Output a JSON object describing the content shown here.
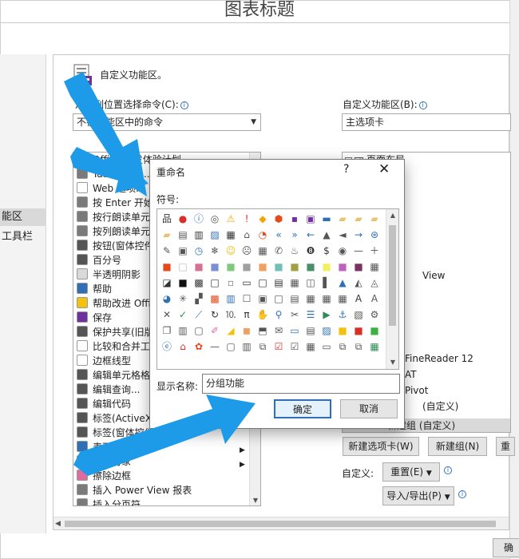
{
  "window": {
    "title": "图表标题",
    "partial_button": "确"
  },
  "nav": {
    "items": [
      {
        "label": "能区",
        "selected": true
      },
      {
        "label": "工具栏",
        "selected": false
      }
    ]
  },
  "panel": {
    "header": "自定义功能区。",
    "left_label": "从下列位置选择命令(C):",
    "left_combo": "不在功能区中的命令",
    "right_label": "自定义功能区(B):",
    "right_combo": "主选项卡"
  },
  "commands": [
    {
      "label": "Office 开发体验计划",
      "icon_color": "#e64a19"
    },
    {
      "label": "Tab 键次序...",
      "icon_color": "#7a7a7a"
    },
    {
      "label": "Web 选项...",
      "icon_color": "#ffffff"
    },
    {
      "label": "按 Enter 开始",
      "icon_color": "#7a7a7a"
    },
    {
      "label": "按行朗读单元格",
      "icon_color": "#7a7a7a"
    },
    {
      "label": "按列朗读单元格",
      "icon_color": "#7a7a7a"
    },
    {
      "label": "按钮(窗体控件)",
      "icon_color": "#555555"
    },
    {
      "label": "百分号",
      "icon_color": "#555555"
    },
    {
      "label": "半透明阴影",
      "icon_color": "#d9d9d9"
    },
    {
      "label": "帮助",
      "icon_color": "#2f6fb5"
    },
    {
      "label": "帮助改进 Office",
      "icon_color": "#f4c20d"
    },
    {
      "label": "保存",
      "icon_color": "#7030a0"
    },
    {
      "label": "保护共享(旧版)",
      "icon_color": "#555555"
    },
    {
      "label": "比较和合并工作簿",
      "icon_color": "#ffffff"
    },
    {
      "label": "边框线型",
      "icon_color": "#ffffff"
    },
    {
      "label": "编辑单元格格式",
      "icon_color": "#555555"
    },
    {
      "label": "编辑查询...",
      "icon_color": "#555555"
    },
    {
      "label": "编辑代码",
      "icon_color": "#555555"
    },
    {
      "label": "标签(ActiveX 控件)",
      "icon_color": "#555555"
    },
    {
      "label": "标签(窗体控件)",
      "icon_color": "#555555"
    },
    {
      "label": "表面(3D)",
      "icon_color": "#2f6fb5"
    },
    {
      "label": "表格对象",
      "icon_color": "#2f6fb5"
    },
    {
      "label": "擦除边框",
      "icon_color": "#e06c9f"
    },
    {
      "label": "插入 Power View 报表",
      "icon_color": "#7a7a7a"
    },
    {
      "label": "插入分页符",
      "icon_color": "#7a7a7a"
    }
  ],
  "tree": {
    "first": "页面布局",
    "partial": [
      "FineReader 12",
      "AT",
      "Pivot",
      "(自定义)"
    ],
    "selected": "新建组 (自定义)",
    "partial_view": "View"
  },
  "right_buttons": {
    "new_tab": "新建选项卡(W)",
    "new_group": "新建组(N)",
    "rename_partial": "重",
    "custom_label": "自定义:",
    "reset": "重置(E)",
    "import_export": "导入/导出(P)"
  },
  "dialog": {
    "title": "重命名",
    "help": "?",
    "close": "✕",
    "symbol_label": "符号:",
    "name_label": "显示名称:",
    "name_value": "分组功能",
    "ok": "确定",
    "cancel": "取消"
  },
  "symbols": [
    {
      "g": "品",
      "c": "#333333"
    },
    {
      "g": "●",
      "c": "#d93025"
    },
    {
      "g": "ⓘ",
      "c": "#2f6fb5"
    },
    {
      "g": "◎",
      "c": "#555555"
    },
    {
      "g": "⚠",
      "c": "#f4a300"
    },
    {
      "g": "!",
      "c": "#d93025"
    },
    {
      "g": "◆",
      "c": "#f4a300"
    },
    {
      "g": "⬢",
      "c": "#e64a19"
    },
    {
      "g": "▪",
      "c": "#7030a0"
    },
    {
      "g": "▣",
      "c": "#7030a0"
    },
    {
      "g": "▬",
      "c": "#2f6fb5"
    },
    {
      "g": "▰",
      "c": "#e8c36a"
    },
    {
      "g": "▰",
      "c": "#e8c36a"
    },
    {
      "g": "▰",
      "c": "#e8c36a"
    },
    {
      "g": "▰",
      "c": "#e8c36a"
    },
    {
      "g": "▤",
      "c": "#555555"
    },
    {
      "g": "▥",
      "c": "#333333"
    },
    {
      "g": "▨",
      "c": "#2f6fb5"
    },
    {
      "g": "▦",
      "c": "#333333"
    },
    {
      "g": "⌂",
      "c": "#555555"
    },
    {
      "g": "◔",
      "c": "#e64a19"
    },
    {
      "g": "«",
      "c": "#2f6fb5"
    },
    {
      "g": "»",
      "c": "#2f6fb5"
    },
    {
      "g": "←",
      "c": "#2f6fb5"
    },
    {
      "g": "▲",
      "c": "#555555"
    },
    {
      "g": "◄",
      "c": "#555555"
    },
    {
      "g": "→",
      "c": "#2f6fb5"
    },
    {
      "g": "⊛",
      "c": "#2f6fb5"
    },
    {
      "g": "✎",
      "c": "#555555"
    },
    {
      "g": "▣",
      "c": "#555555"
    },
    {
      "g": "◷",
      "c": "#2f6fb5"
    },
    {
      "g": "❄",
      "c": "#555555"
    },
    {
      "g": "☺",
      "c": "#f4c20d"
    },
    {
      "g": "☹",
      "c": "#555555"
    },
    {
      "g": "▦",
      "c": "#555555"
    },
    {
      "g": "✆",
      "c": "#555555"
    },
    {
      "g": "♨",
      "c": "#555555"
    },
    {
      "g": "❽",
      "c": "#333333"
    },
    {
      "g": "$",
      "c": "#333333"
    },
    {
      "g": "◉",
      "c": "#555555"
    },
    {
      "g": "—",
      "c": "#555555"
    },
    {
      "g": "＋",
      "c": "#555555"
    },
    {
      "g": "■",
      "c": "#e64a19"
    },
    {
      "g": "□",
      "c": "#bbbbbb"
    },
    {
      "g": "■",
      "c": "#d87093"
    },
    {
      "g": "■",
      "c": "#7b8fd6"
    },
    {
      "g": "■",
      "c": "#7fc97f"
    },
    {
      "g": "■",
      "c": "#a0a0a0"
    },
    {
      "g": "■",
      "c": "#f0a060"
    },
    {
      "g": "■",
      "c": "#70c0b8"
    },
    {
      "g": "■",
      "c": "#a0a040"
    },
    {
      "g": "■",
      "c": "#4a8f6a"
    },
    {
      "g": "■",
      "c": "#f0f060"
    },
    {
      "g": "■",
      "c": "#c060c0"
    },
    {
      "g": "■",
      "c": "#7a3060"
    },
    {
      "g": "▦",
      "c": "#555555"
    },
    {
      "g": "◪",
      "c": "#333333"
    },
    {
      "g": "■",
      "c": "#111111"
    },
    {
      "g": "▩",
      "c": "#333333"
    },
    {
      "g": "□",
      "c": "#333333"
    },
    {
      "g": "▫",
      "c": "#777777"
    },
    {
      "g": "▭",
      "c": "#333333"
    },
    {
      "g": "□",
      "c": "#333333"
    },
    {
      "g": "▤",
      "c": "#333333"
    },
    {
      "g": "▦",
      "c": "#555555"
    },
    {
      "g": "◫",
      "c": "#555555"
    },
    {
      "g": "▌",
      "c": "#555555"
    },
    {
      "g": "▲",
      "c": "#2f6fb5"
    },
    {
      "g": "◭",
      "c": "#555555"
    },
    {
      "g": "◬",
      "c": "#555555"
    },
    {
      "g": "◕",
      "c": "#2f6fb5"
    },
    {
      "g": "✳",
      "c": "#555555"
    },
    {
      "g": "▞",
      "c": "#555555"
    },
    {
      "g": "▩",
      "c": "#e64a19"
    },
    {
      "g": "▥",
      "c": "#2f6fb5"
    },
    {
      "g": "☐",
      "c": "#555555"
    },
    {
      "g": "▣",
      "c": "#555555"
    },
    {
      "g": "□",
      "c": "#555555"
    },
    {
      "g": "▤",
      "c": "#555555"
    },
    {
      "g": "▦",
      "c": "#555555"
    },
    {
      "g": "▦",
      "c": "#555555"
    },
    {
      "g": "▦",
      "c": "#555555"
    },
    {
      "g": "A",
      "c": "#333333"
    },
    {
      "g": "A",
      "c": "#555555"
    },
    {
      "g": "✕",
      "c": "#555555"
    },
    {
      "g": "✓",
      "c": "#2e8b57"
    },
    {
      "g": "⟋",
      "c": "#2f6fb5"
    },
    {
      "g": "↻",
      "c": "#333333"
    },
    {
      "g": "⒑",
      "c": "#555555"
    },
    {
      "g": "π",
      "c": "#333333"
    },
    {
      "g": "✋",
      "c": "#555555"
    },
    {
      "g": "⚲",
      "c": "#2f6fb5"
    },
    {
      "g": "✂",
      "c": "#555555"
    },
    {
      "g": "☰",
      "c": "#2f6fb5"
    },
    {
      "g": "▶",
      "c": "#2e8b57"
    },
    {
      "g": "⚓",
      "c": "#2f6fb5"
    },
    {
      "g": "▧",
      "c": "#555555"
    },
    {
      "g": "⚙",
      "c": "#555555"
    },
    {
      "g": "❐",
      "c": "#555555"
    },
    {
      "g": "▥",
      "c": "#555555"
    },
    {
      "g": "▢",
      "c": "#555555"
    },
    {
      "g": "✐",
      "c": "#e06c9f"
    },
    {
      "g": "◢",
      "c": "#f4c20d"
    },
    {
      "g": "◼",
      "c": "#f0a060"
    },
    {
      "g": "⬒",
      "c": "#555555"
    },
    {
      "g": "✉",
      "c": "#555555"
    },
    {
      "g": "▭",
      "c": "#2f6fb5"
    },
    {
      "g": "▤",
      "c": "#555555"
    },
    {
      "g": "▨",
      "c": "#2f6fb5"
    },
    {
      "g": "■",
      "c": "#f4c20d"
    },
    {
      "g": "■",
      "c": "#d93025"
    },
    {
      "g": "■",
      "c": "#3cb043"
    },
    {
      "g": "ⓔ",
      "c": "#2f6fb5"
    },
    {
      "g": "⌂",
      "c": "#d93025"
    },
    {
      "g": "✿",
      "c": "#e64a19"
    },
    {
      "g": "—",
      "c": "#555555"
    },
    {
      "g": "▢",
      "c": "#555555"
    },
    {
      "g": "▥",
      "c": "#555555"
    },
    {
      "g": "⧉",
      "c": "#555555"
    },
    {
      "g": "☑",
      "c": "#d93025"
    },
    {
      "g": "☑",
      "c": "#555555"
    },
    {
      "g": "▦",
      "c": "#555555"
    },
    {
      "g": "▭",
      "c": "#555555"
    },
    {
      "g": "⧉",
      "c": "#555555"
    },
    {
      "g": "⧉",
      "c": "#555555"
    },
    {
      "g": "▦",
      "c": "#2e8b57"
    }
  ],
  "colors": {
    "accent": "#2f6fb5",
    "arrow": "#1e9be8",
    "selection": "#d9d9d9"
  }
}
